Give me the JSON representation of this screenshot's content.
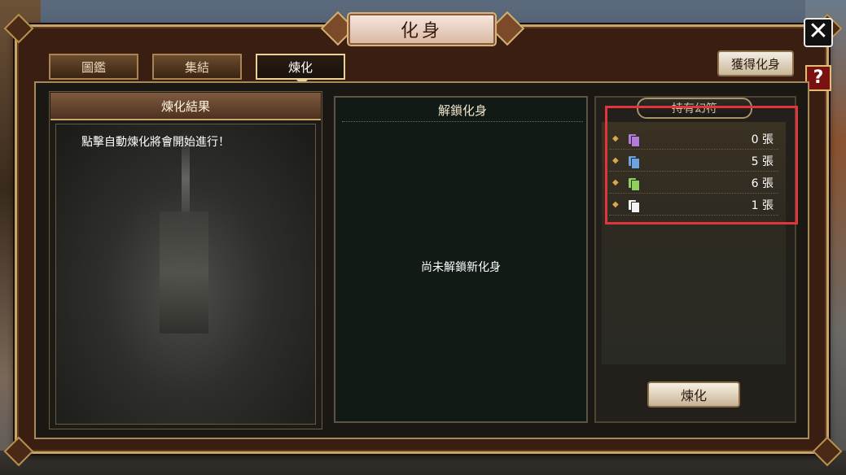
{
  "window": {
    "title": "化身"
  },
  "tabs": [
    {
      "label": "圖鑑",
      "active": false
    },
    {
      "label": "集結",
      "active": false
    },
    {
      "label": "煉化",
      "active": true
    }
  ],
  "header_buttons": {
    "acquire_label": "獲得化身",
    "help_label": "?",
    "close_label": "✕"
  },
  "left_panel": {
    "title": "煉化結果",
    "message": "點擊自動煉化將會開始進行！"
  },
  "middle_panel": {
    "title": "解鎖化身",
    "message": "尚未解鎖新化身"
  },
  "right_panel": {
    "title": "持有幻符",
    "charms": [
      {
        "icon": "purple-charm-icon",
        "color": "#b07cd8",
        "count": "0 張"
      },
      {
        "icon": "blue-charm-icon",
        "color": "#6ea2e0",
        "count": "5 張"
      },
      {
        "icon": "green-charm-icon",
        "color": "#8fd05a",
        "count": "6 張"
      },
      {
        "icon": "white-charm-icon",
        "color": "#f2f2f2",
        "count": "1 張"
      }
    ],
    "refine_label": "煉化"
  },
  "colors": {
    "accent_gold": "#c7a56a",
    "highlight_red": "#e0353a",
    "frame_brown": "#3a1e12"
  }
}
